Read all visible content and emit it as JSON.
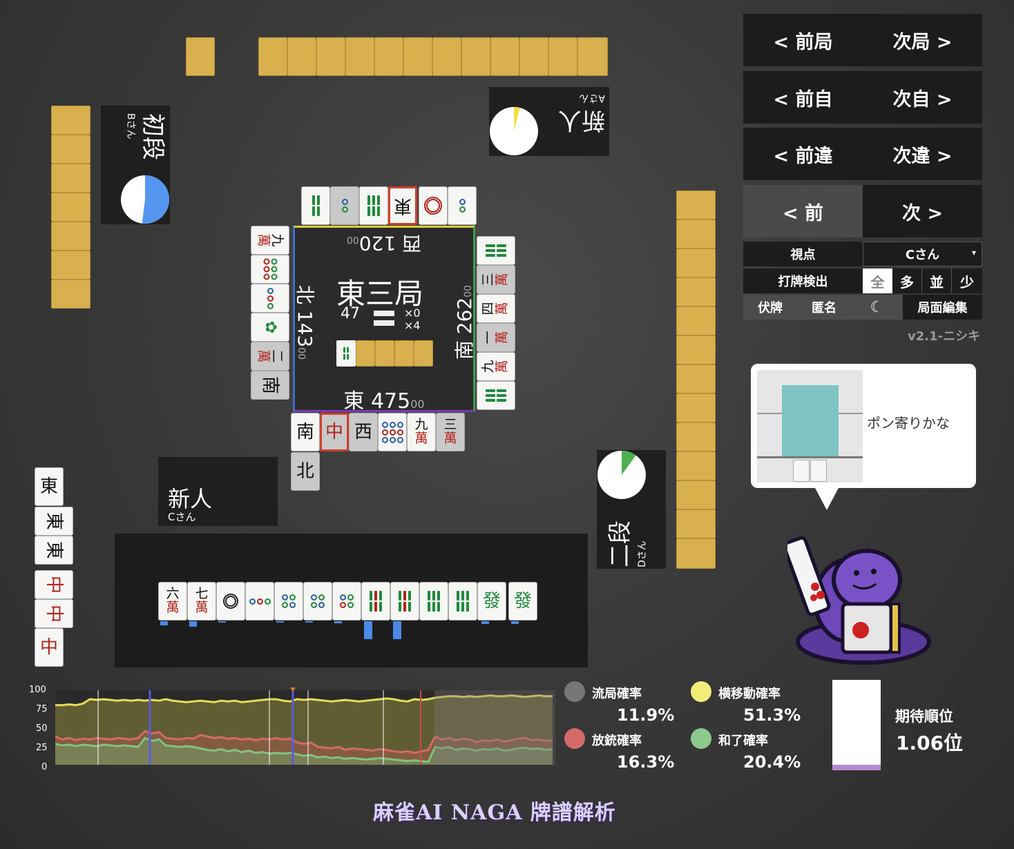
{
  "colors": {
    "tile_back": "#d8b04e",
    "east_border": "#d9cc3a",
    "south_border": "#3aa04a",
    "west_border": "#7a3ab0",
    "north_border": "#3a6ed0",
    "chart_yellow": "#e8dc5a",
    "chart_red": "#d46a6a",
    "chart_green": "#7fc47f",
    "chart_gray": "#777777"
  },
  "players": {
    "left": {
      "rank": "初段",
      "handle": "Bさん",
      "pie_percent": 52,
      "pie_color": "#5596f0"
    },
    "top": {
      "rank": "新人",
      "handle": "Aさん",
      "pie_percent": 4,
      "pie_color": "#f0e040"
    },
    "right": {
      "rank": "二段",
      "handle": "Dさん",
      "pie_percent": 10,
      "pie_color": "#4caf50"
    },
    "self": {
      "rank": "新人",
      "handle": "Cさん"
    }
  },
  "center": {
    "round": "東三局",
    "tiles_left": "47",
    "honba": "×0",
    "riichi": "×4",
    "seat_top": "西 120",
    "seat_top_small": "00",
    "seat_left": "北 143",
    "seat_left_small": "00",
    "seat_right": "南 262",
    "seat_right_small": "00",
    "seat_bottom": "東 475",
    "seat_bottom_small": "00"
  },
  "nav": {
    "prev_round": "< 前局",
    "next_round": "次局 >",
    "prev_self": "< 前自",
    "next_self": "次自 >",
    "prev_diff": "< 前違",
    "next_diff": "次違 >",
    "prev": "< 前",
    "next": "次 >"
  },
  "settings": {
    "viewpoint_label": "視点",
    "viewpoint_value": "Cさん",
    "detect_label": "打牌検出",
    "detect_options": [
      "全",
      "多",
      "並",
      "少"
    ],
    "hide_tiles": "伏牌",
    "anonymous": "匿名",
    "moon_icon": "☾",
    "edit": "局面編集",
    "version": "v2.1-ニシキ"
  },
  "bubble": {
    "text": "ポン寄りかな"
  },
  "legend": {
    "ryukyoku_label": "流局確率",
    "ryukyoku_value": "11.9%",
    "yoko_label": "横移動確率",
    "yoko_value": "51.3%",
    "houjuu_label": "放銃確率",
    "houjuu_value": "16.3%",
    "agari_label": "和了確率",
    "agari_value": "20.4%",
    "expected_label": "期待順位",
    "expected_value": "1.06位",
    "expected_fill": 0.06
  },
  "chart_data": {
    "type": "area",
    "yticks": [
      "100",
      "75",
      "50",
      "25",
      "0"
    ],
    "ylim": [
      0,
      100
    ],
    "series": [
      {
        "name": "横移動確率",
        "values": [
          80,
          80,
          81,
          80,
          82,
          88,
          87,
          88,
          87,
          86,
          87,
          86,
          87,
          86,
          87,
          86,
          88,
          86,
          85,
          84,
          85,
          86,
          85,
          84,
          86,
          85,
          86,
          84,
          85,
          86,
          87,
          88,
          88,
          86,
          85,
          88,
          87,
          88,
          87,
          86,
          85,
          86,
          87,
          86,
          85,
          86,
          87,
          88,
          89,
          88,
          86,
          85,
          88,
          87,
          88,
          90,
          91,
          92,
          92,
          91,
          92,
          91,
          92,
          93,
          92,
          92,
          93,
          92,
          91,
          92,
          93,
          92,
          92
        ]
      },
      {
        "name": "放銃確率",
        "values": [
          38,
          34,
          36,
          33,
          35,
          34,
          36,
          35,
          34,
          36,
          35,
          34,
          36,
          45,
          42,
          44,
          36,
          35,
          34,
          36,
          35,
          40,
          38,
          36,
          37,
          35,
          36,
          34,
          35,
          33,
          35,
          34,
          36,
          34,
          35,
          30,
          28,
          30,
          24,
          23,
          22,
          24,
          20,
          22,
          21,
          20,
          19,
          21,
          20,
          18,
          17,
          18,
          16,
          18,
          20,
          38,
          34,
          36,
          33,
          35,
          34,
          30,
          33,
          32,
          34,
          31,
          33,
          35,
          36,
          33,
          34,
          32,
          33
        ]
      },
      {
        "name": "和了確率",
        "values": [
          28,
          26,
          27,
          25,
          27,
          26,
          25,
          27,
          26,
          25,
          26,
          25,
          24,
          36,
          32,
          34,
          26,
          25,
          24,
          25,
          24,
          22,
          20,
          19,
          21,
          18,
          20,
          17,
          19,
          16,
          17,
          15,
          16,
          15,
          16,
          14,
          12,
          13,
          10,
          11,
          9,
          10,
          8,
          9,
          8,
          7,
          8,
          9,
          8,
          7,
          6,
          5,
          6,
          5,
          4,
          24,
          22,
          24,
          20,
          22,
          21,
          19,
          21,
          20,
          22,
          19,
          20,
          22,
          23,
          21,
          22,
          20,
          21
        ]
      }
    ]
  },
  "footer": {
    "title": "麻雀AI NAGA 牌譜解析"
  }
}
